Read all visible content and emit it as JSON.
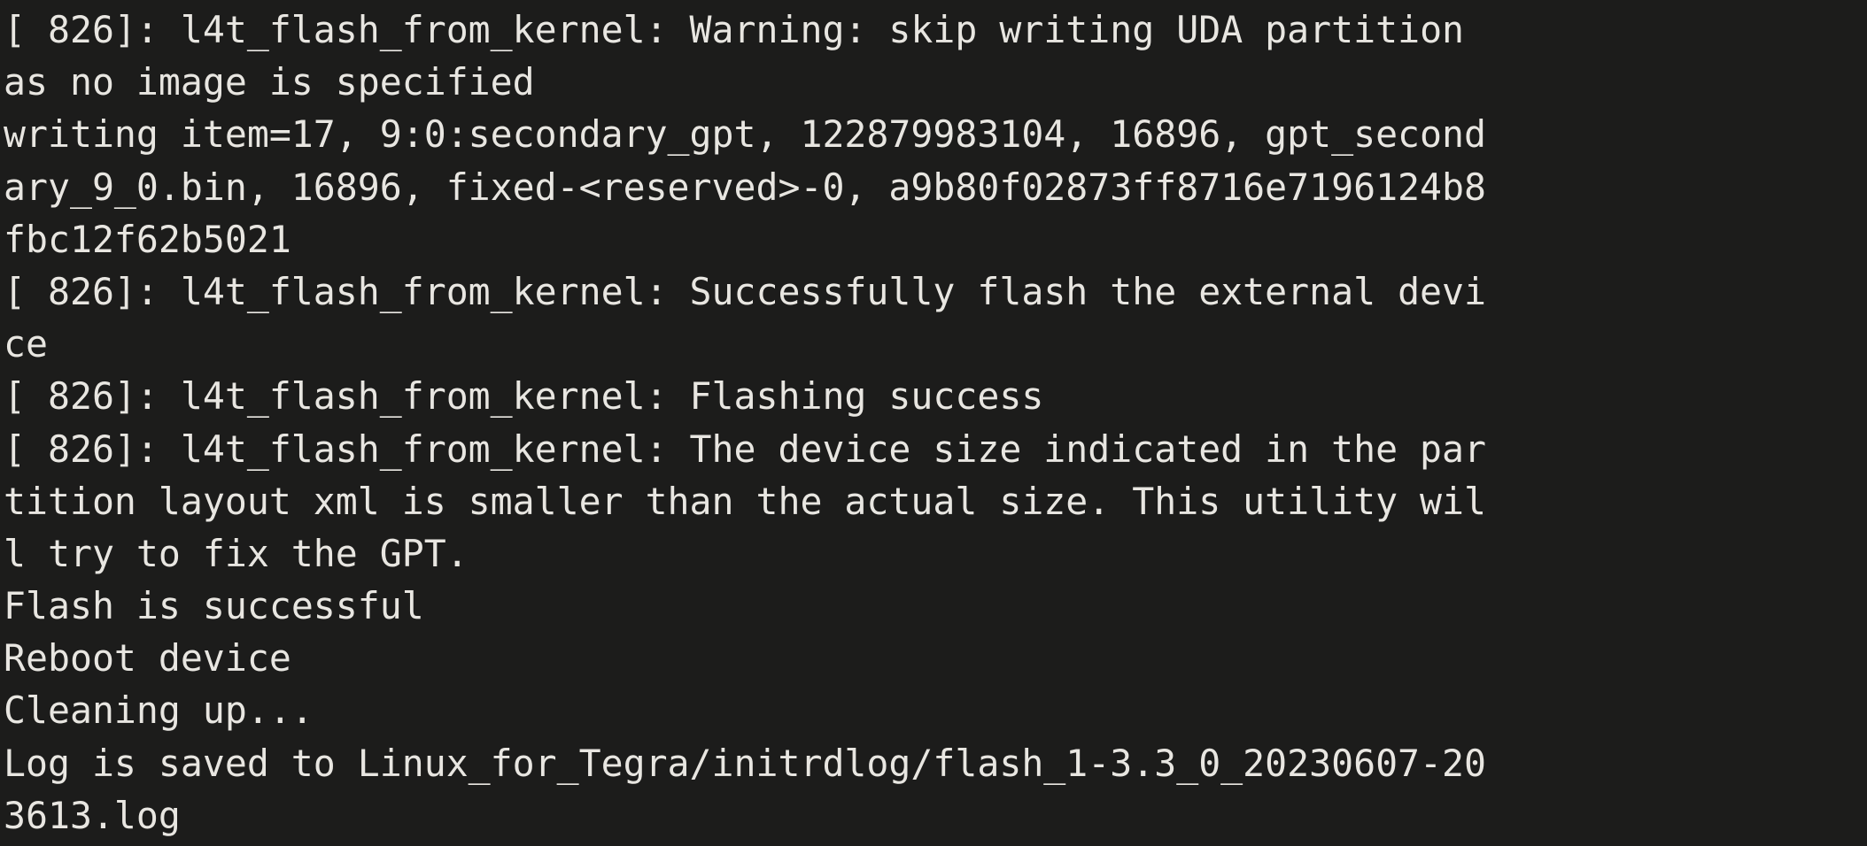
{
  "terminal": {
    "window_title": "Terminal",
    "background_color": "#1c1c1b",
    "default_text_color": "#e8e6e1",
    "warning_color": "#e8e234",
    "success_color": "#42e398",
    "font_family": "monospace",
    "columns": 51,
    "log_prefix": "[ 826]: l4t_flash_from_kernel: ",
    "lines": [
      {
        "id": "line-1-warning-uda",
        "segments": [
          {
            "text": "[ 826]: l4t_flash_from_kernel: ",
            "color": "default"
          },
          {
            "text": "Warning",
            "color": "warning"
          },
          {
            "text": ": skip writing UDA partition",
            "color": "default"
          }
        ]
      },
      {
        "id": "line-2-warning-uda-wrap",
        "segments": [
          {
            "text": "as no image is specified",
            "color": "default"
          }
        ]
      },
      {
        "id": "line-3-writing-item",
        "segments": [
          {
            "text": "writing item=17, 9:0:secondary_gpt, 122879983104, 16896, gpt_second",
            "color": "default"
          }
        ]
      },
      {
        "id": "line-4-writing-item-wrap-1",
        "segments": [
          {
            "text": "ary_9_0.bin, 16896, fixed-<reserved>-0, a9b80f02873ff8716e7196124b8",
            "color": "default"
          }
        ]
      },
      {
        "id": "line-5-writing-item-wrap-2",
        "segments": [
          {
            "text": "fbc12f62b5021",
            "color": "default"
          }
        ]
      },
      {
        "id": "line-6-successfully-flash",
        "segments": [
          {
            "text": "[ 826]: l4t_flash_from_kernel: ",
            "color": "default"
          },
          {
            "text": "Successfully",
            "color": "success"
          },
          {
            "text": " flash the external devi",
            "color": "default"
          }
        ]
      },
      {
        "id": "line-7-successfully-flash-wrap",
        "segments": [
          {
            "text": "ce",
            "color": "default"
          }
        ]
      },
      {
        "id": "line-8-flashing-success",
        "segments": [
          {
            "text": "[ 826]: l4t_flash_from_kernel: Flashing ",
            "color": "default"
          },
          {
            "text": "success",
            "color": "success"
          }
        ]
      },
      {
        "id": "line-9-device-size-note",
        "segments": [
          {
            "text": "[ 826]: l4t_flash_from_kernel: The device size indicated in the par",
            "color": "default"
          }
        ]
      },
      {
        "id": "line-10-device-size-note-wrap-1",
        "segments": [
          {
            "text": "tition layout xml is smaller than the actual size. This utility wil",
            "color": "default"
          }
        ]
      },
      {
        "id": "line-11-device-size-note-wrap-2",
        "segments": [
          {
            "text": "l try to fix the GPT.",
            "color": "default"
          }
        ]
      },
      {
        "id": "line-12-flash-successful",
        "segments": [
          {
            "text": "Flash is ",
            "color": "default"
          },
          {
            "text": "successful",
            "color": "success"
          }
        ]
      },
      {
        "id": "line-13-reboot-device",
        "segments": [
          {
            "text": "Reboot device",
            "color": "default"
          }
        ]
      },
      {
        "id": "line-14-cleaning-up",
        "segments": [
          {
            "text": "Cleaning up...",
            "color": "default"
          }
        ]
      },
      {
        "id": "line-15-log-saved",
        "segments": [
          {
            "text": "Log is saved to Linux_for_Tegra/initrdlog/flash_1-3.3_0_20230607-20",
            "color": "default"
          }
        ]
      },
      {
        "id": "line-16-log-saved-wrap",
        "segments": [
          {
            "text": "3613.log",
            "color": "default"
          }
        ]
      }
    ]
  }
}
